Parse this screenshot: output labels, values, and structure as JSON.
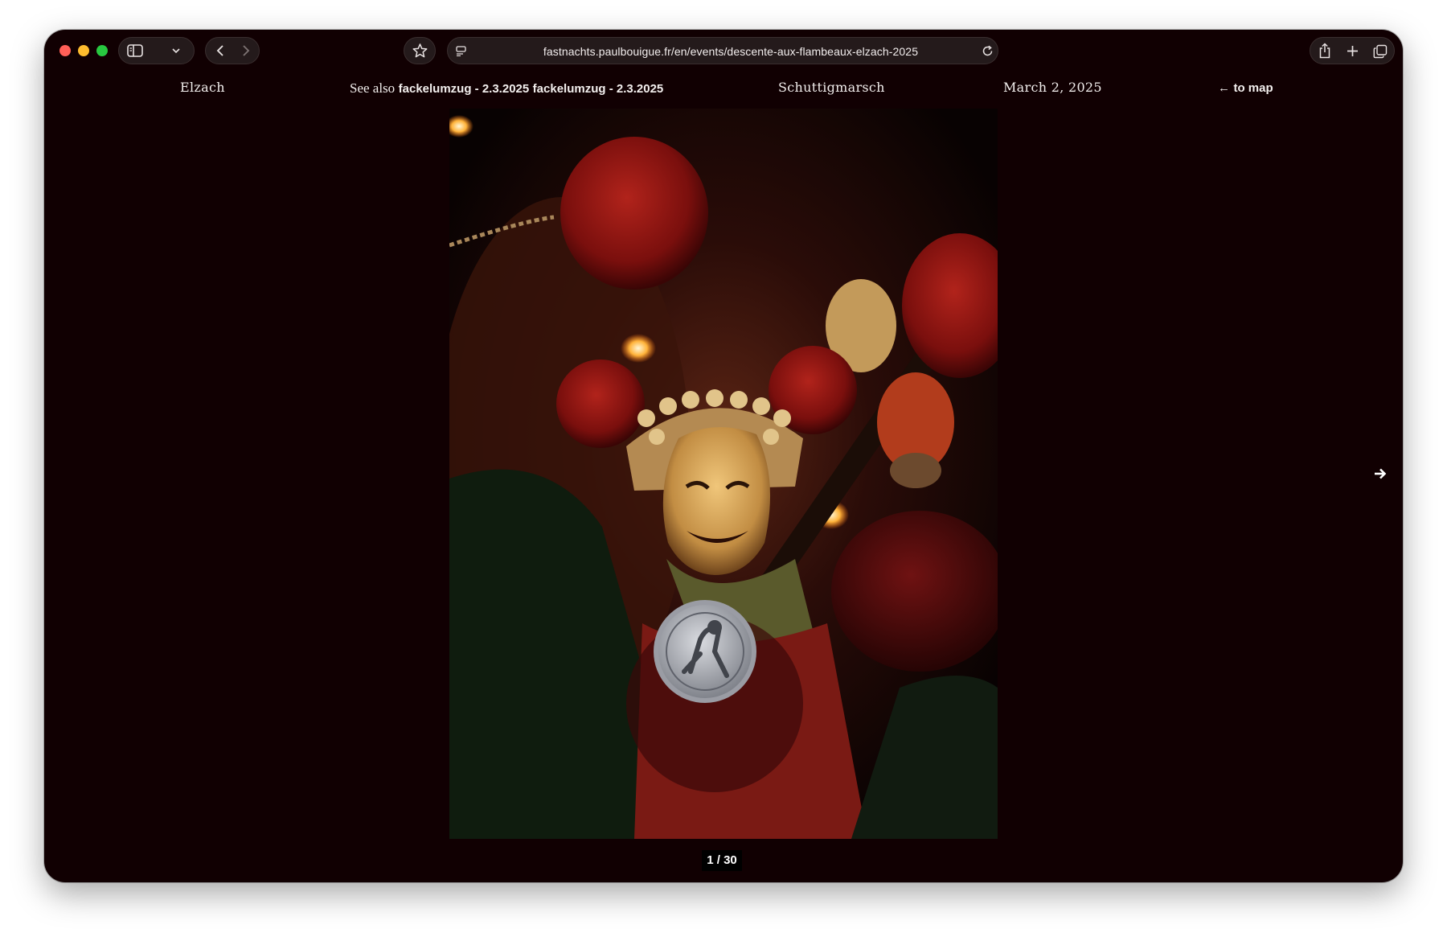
{
  "browser": {
    "url": "fastnachts.paulbouigue.fr/en/events/descente-aux-flambeaux-elzach-2025",
    "icons": [
      "sidebar-icon",
      "chevron-down-icon",
      "back-arrow-icon",
      "forward-arrow-icon",
      "star-icon",
      "reader-icon",
      "reload-icon",
      "share-icon",
      "plus-icon",
      "tabs-icon"
    ]
  },
  "header": {
    "location": "Elzach",
    "see_also_label": "See also",
    "see_also_links": [
      "fackelumzug - 2.3.2025",
      "fackelumzug - 2.3.2025"
    ],
    "group": "Schuttigmarsch",
    "date": "March 2, 2025",
    "map_arrow": "←",
    "map_link": "to map"
  },
  "gallery": {
    "counter": "1 / 30",
    "next_icon": "arrow-right-icon"
  },
  "colors": {
    "page_background": "#110002",
    "text": "#f3efee",
    "counter_background": "#000000"
  }
}
